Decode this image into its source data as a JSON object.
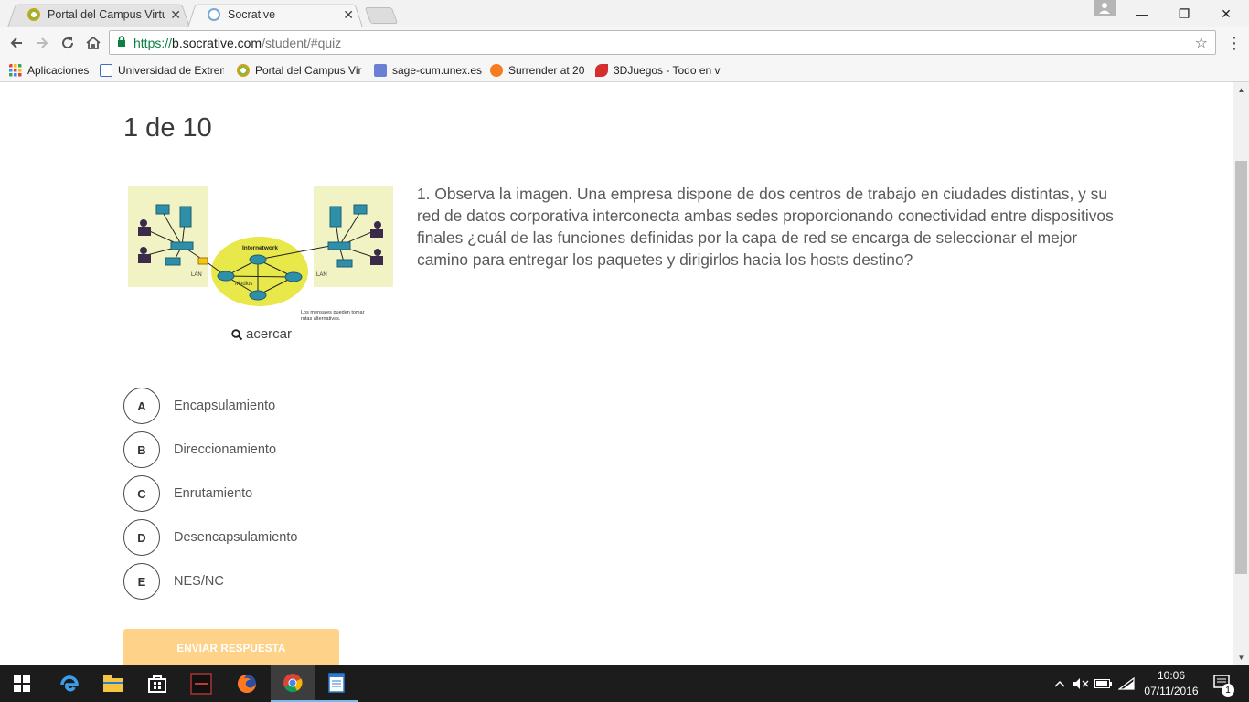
{
  "browser": {
    "tabs": [
      {
        "title": "Portal del Campus Virtua",
        "favicon_color": "#d4a017",
        "active": false
      },
      {
        "title": "Socrative",
        "favicon_color": "#6aa7d8",
        "active": true
      }
    ],
    "url": {
      "scheme": "https://",
      "host": "b.socrative.com",
      "path": "/student/#quiz"
    },
    "bookmarks": [
      {
        "label": "Aplicaciones",
        "icon": "apps-grid-icon"
      },
      {
        "label": "Universidad de Extrem",
        "icon": "page-icon"
      },
      {
        "label": "Portal del Campus Vir",
        "icon": "campus-icon"
      },
      {
        "label": "sage-cum.unex.es",
        "icon": "sage-icon"
      },
      {
        "label": "Surrender at 20",
        "icon": "surrender-icon"
      },
      {
        "label": "3DJuegos - Todo en v",
        "icon": "3djuegos-icon"
      }
    ]
  },
  "quiz": {
    "counter": "1 de 10",
    "question": "1. Observa la imagen. Una empresa dispone de dos centros de trabajo en ciudades distintas, y su red de datos corporativa interconecta ambas sedes proporcionando conectividad entre dispositivos finales ¿cuál de las funciones definidas por la capa de red se encarga de seleccionar el mejor camino para entregar los paquetes y dirigirlos hacia los hosts destino?",
    "zoom_label": "acercar",
    "figure": {
      "internetwork_label": "Internetwork",
      "lan_left": "LAN",
      "lan_right": "LAN",
      "medios_label": "Medios",
      "caption_line1": "Los mensajes pueden tomar",
      "caption_line2": "rutas alternativas."
    },
    "answers": [
      {
        "letter": "A",
        "text": "Encapsulamiento"
      },
      {
        "letter": "B",
        "text": "Direccionamiento"
      },
      {
        "letter": "C",
        "text": "Enrutamiento"
      },
      {
        "letter": "D",
        "text": "Desencapsulamiento"
      },
      {
        "letter": "E",
        "text": "NES/NC"
      }
    ],
    "submit_label": "ENVIAR RESPUESTA"
  },
  "taskbar": {
    "clock_time": "10:06",
    "clock_date": "07/11/2016",
    "notification_count": "1"
  },
  "colors": {
    "submit_bg": "#fed289",
    "taskbar_bg": "#1c1c1c",
    "secure_green": "#0b8043"
  }
}
